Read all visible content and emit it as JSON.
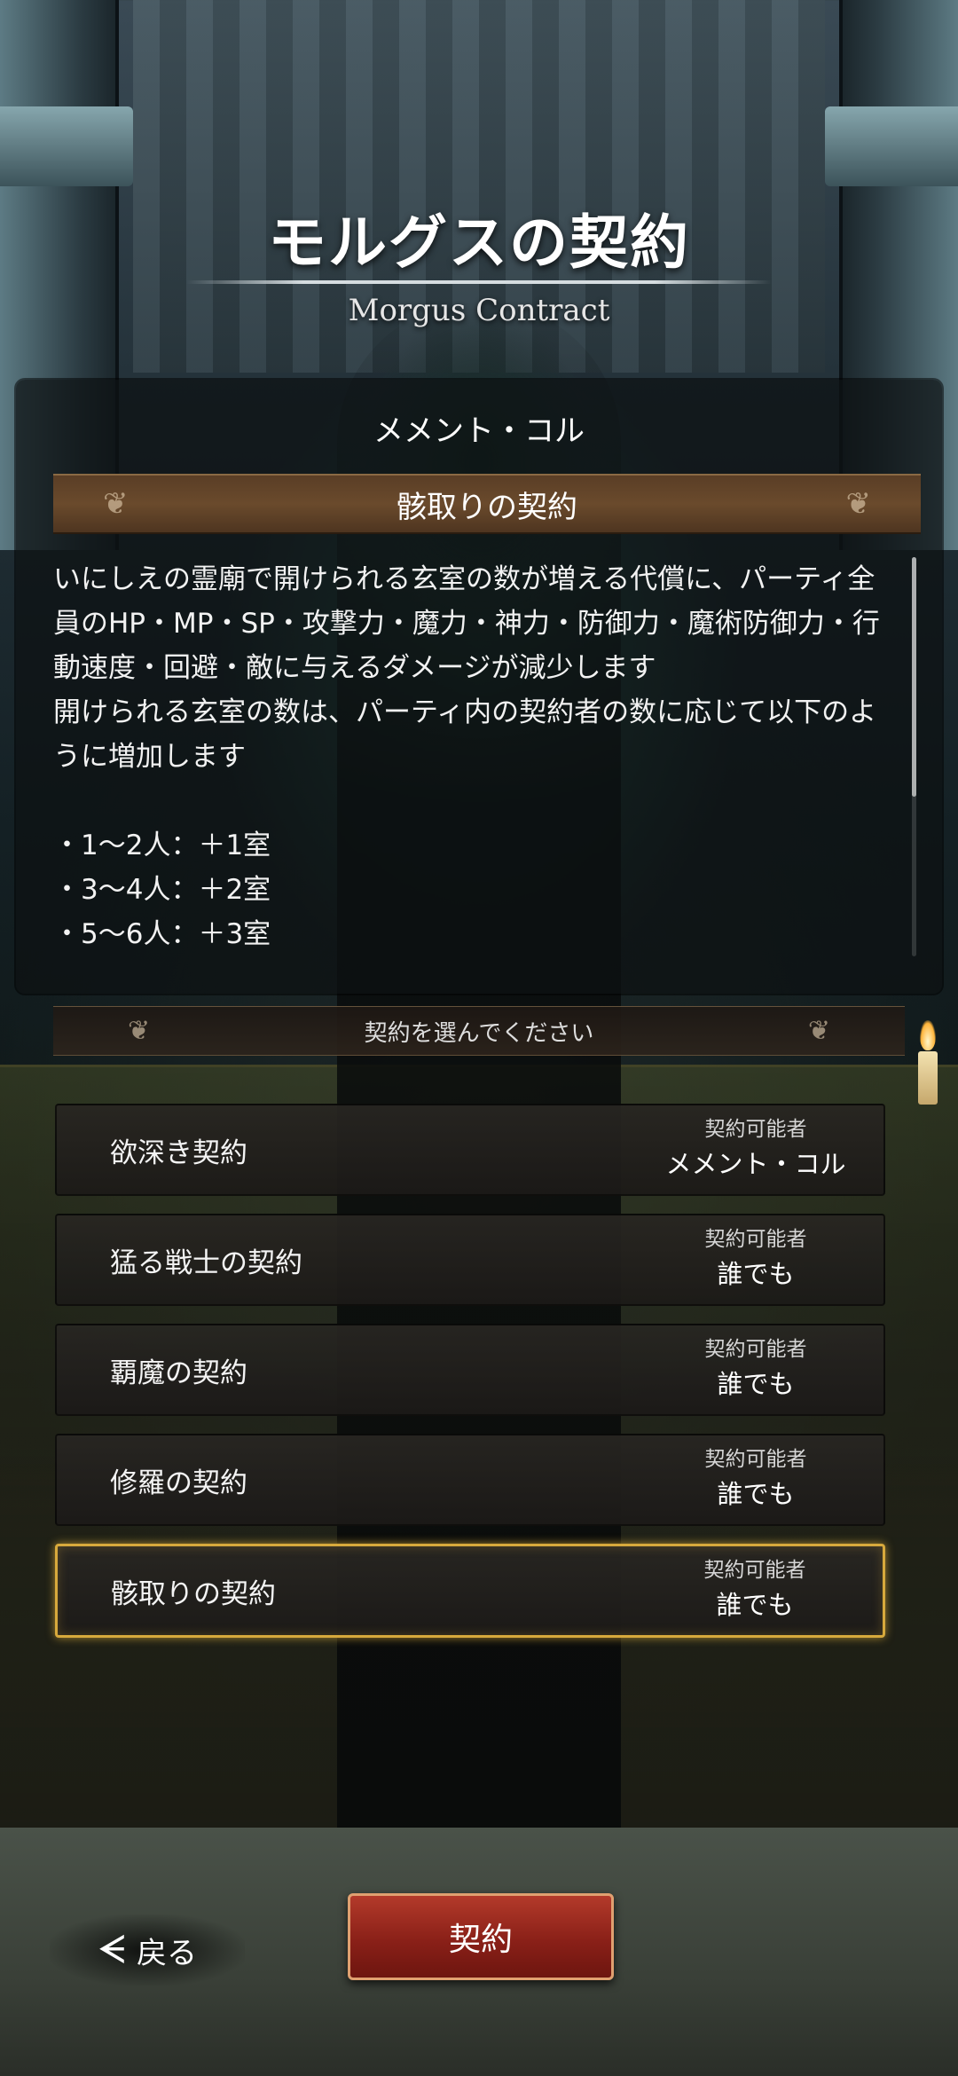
{
  "header": {
    "title": "モルグスの契約",
    "subtitle": "Morgus Contract"
  },
  "panel": {
    "character_name": "メメント・コル",
    "contract_title": "骸取りの契約",
    "description": [
      "いにしえの霊廟で開けられる玄室の数が増える代償に、パーティ全員のHP・MP・SP・攻撃力・魔力・神力・防御力・魔術防御力・行動速度・回避・敵に与えるダメージが減少します",
      "開けられる玄室の数は、パーティ内の契約者の数に応じて以下のように増加します",
      "",
      "・1～2人：＋1室",
      "・3～4人：＋2室",
      "・5～6人：＋3室"
    ]
  },
  "prompt": "契約を選んでください",
  "contracts": [
    {
      "name": "欲深き契約",
      "meta_label": "契約可能者",
      "meta_value": "メメント・コル",
      "selected": false
    },
    {
      "name": "猛る戦士の契約",
      "meta_label": "契約可能者",
      "meta_value": "誰でも",
      "selected": false
    },
    {
      "name": "覇魔の契約",
      "meta_label": "契約可能者",
      "meta_value": "誰でも",
      "selected": false
    },
    {
      "name": "修羅の契約",
      "meta_label": "契約可能者",
      "meta_value": "誰でも",
      "selected": false
    },
    {
      "name": "骸取りの契約",
      "meta_label": "契約可能者",
      "meta_value": "誰でも",
      "selected": true
    }
  ],
  "footer": {
    "back_label": "戻る",
    "back_icon": "back-arrow-icon",
    "contract_button": "契約"
  },
  "colors": {
    "selected_border": "#d7a93c",
    "contract_button": "#8a2018",
    "banner": "#6a4a2c"
  }
}
